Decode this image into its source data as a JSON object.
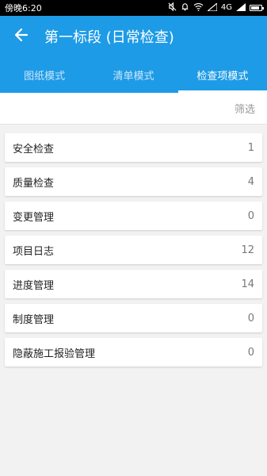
{
  "status_bar": {
    "time": "傍晚6:20",
    "network": "4G",
    "battery_level": 0.8
  },
  "header": {
    "title": "第一标段 (日常检查)"
  },
  "tabs": [
    {
      "label": "图纸模式",
      "active": false
    },
    {
      "label": "清单模式",
      "active": false
    },
    {
      "label": "检查项模式",
      "active": true
    }
  ],
  "filter": {
    "label": "筛选"
  },
  "items": [
    {
      "label": "安全检查",
      "count": "1"
    },
    {
      "label": "质量检查",
      "count": "4"
    },
    {
      "label": "变更管理",
      "count": "0"
    },
    {
      "label": "项目日志",
      "count": "12"
    },
    {
      "label": "进度管理",
      "count": "14"
    },
    {
      "label": "制度管理",
      "count": "0"
    },
    {
      "label": "隐蔽施工报验管理",
      "count": "0"
    }
  ],
  "colors": {
    "primary": "#1e9be6"
  }
}
